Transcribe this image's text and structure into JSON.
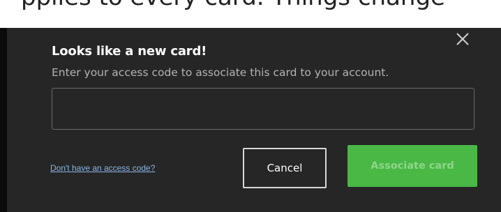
{
  "background_text": "pplies to every card.  Things change",
  "dialog": {
    "title": "Looks like a new card!",
    "subtitle": "Enter your access code to associate this card to your account.",
    "access_code_input": {
      "value": "",
      "placeholder": ""
    },
    "help_link_label": "Don't have an access code?",
    "cancel_label": "Cancel",
    "associate_label": "Associate card",
    "close_icon": "close-icon"
  },
  "colors": {
    "dialog_background": "#262626",
    "accent_green": "#49b845",
    "link_blue": "#8ab6e6",
    "input_border": "#6a6a6a"
  }
}
